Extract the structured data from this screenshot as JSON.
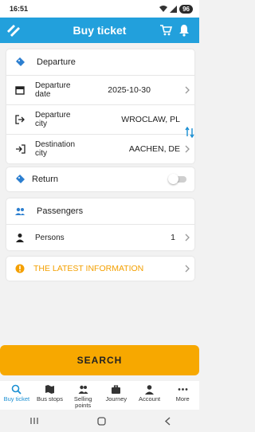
{
  "status_bar": {
    "time": "16:51",
    "battery": "96"
  },
  "app_bar": {
    "title": "Buy ticket"
  },
  "departure": {
    "header": "Departure",
    "date_label": "Departure date",
    "date_value": "2025-10-30",
    "from_label": "Departure city",
    "from_value": "WROCLAW, PL",
    "to_label": "Destination city",
    "to_value": "AACHEN, DE"
  },
  "return": {
    "label": "Return",
    "enabled": false
  },
  "passengers": {
    "header": "Passengers",
    "persons_label": "Persons",
    "persons_value": "1"
  },
  "info": {
    "label": "THE LATEST INFORMATION"
  },
  "search_button": "SEARCH",
  "bottom_nav": [
    {
      "label": "Buy ticket",
      "icon": "search-icon",
      "active": true
    },
    {
      "label": "Bus stops",
      "icon": "map-icon"
    },
    {
      "label": "Selling points",
      "icon": "people-icon"
    },
    {
      "label": "Journey",
      "icon": "briefcase-icon"
    },
    {
      "label": "Account",
      "icon": "person-icon"
    },
    {
      "label": "More",
      "icon": "dots-icon"
    }
  ],
  "colors": {
    "primary": "#22a0dc",
    "accent": "#f7a800",
    "active_nav": "#1a8fd3"
  }
}
